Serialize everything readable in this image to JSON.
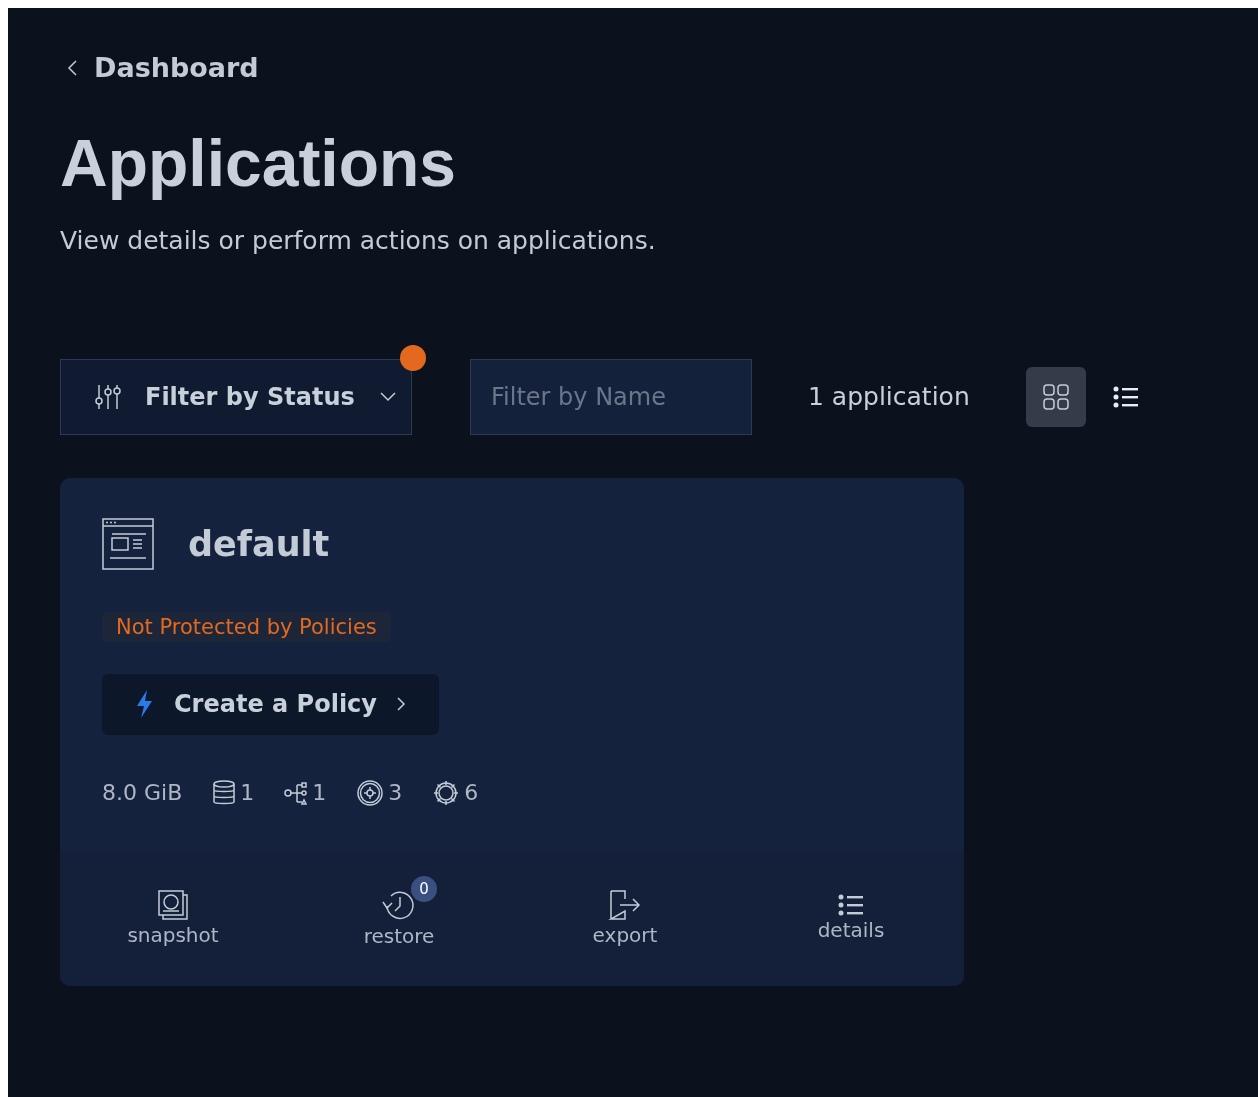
{
  "breadcrumb": {
    "label": "Dashboard"
  },
  "title": "Applications",
  "subtitle": "View details or perform actions on applications.",
  "toolbar": {
    "status_filter": {
      "label": "Filter by Status",
      "indicator": true
    },
    "name_filter": {
      "placeholder": "Filter by Name"
    },
    "count": "1 application",
    "views": [
      {
        "kind": "grid",
        "selected": true
      },
      {
        "kind": "list",
        "selected": false
      }
    ]
  },
  "cards": [
    {
      "name": "default",
      "status": "Not Protected by Policies",
      "action": {
        "label": "Create a Policy"
      },
      "stats": [
        {
          "kind": "size",
          "value": "8.0 GiB"
        },
        {
          "kind": "volumes",
          "value": "1"
        },
        {
          "kind": "services",
          "value": "1"
        },
        {
          "kind": "workloads",
          "value": "3"
        },
        {
          "kind": "resources",
          "value": "6"
        }
      ],
      "actions": [
        {
          "kind": "snapshot",
          "label": "snapshot"
        },
        {
          "kind": "restore",
          "label": "restore",
          "badge": "0"
        },
        {
          "kind": "export",
          "label": "export"
        },
        {
          "kind": "details",
          "label": "details"
        }
      ]
    }
  ]
}
